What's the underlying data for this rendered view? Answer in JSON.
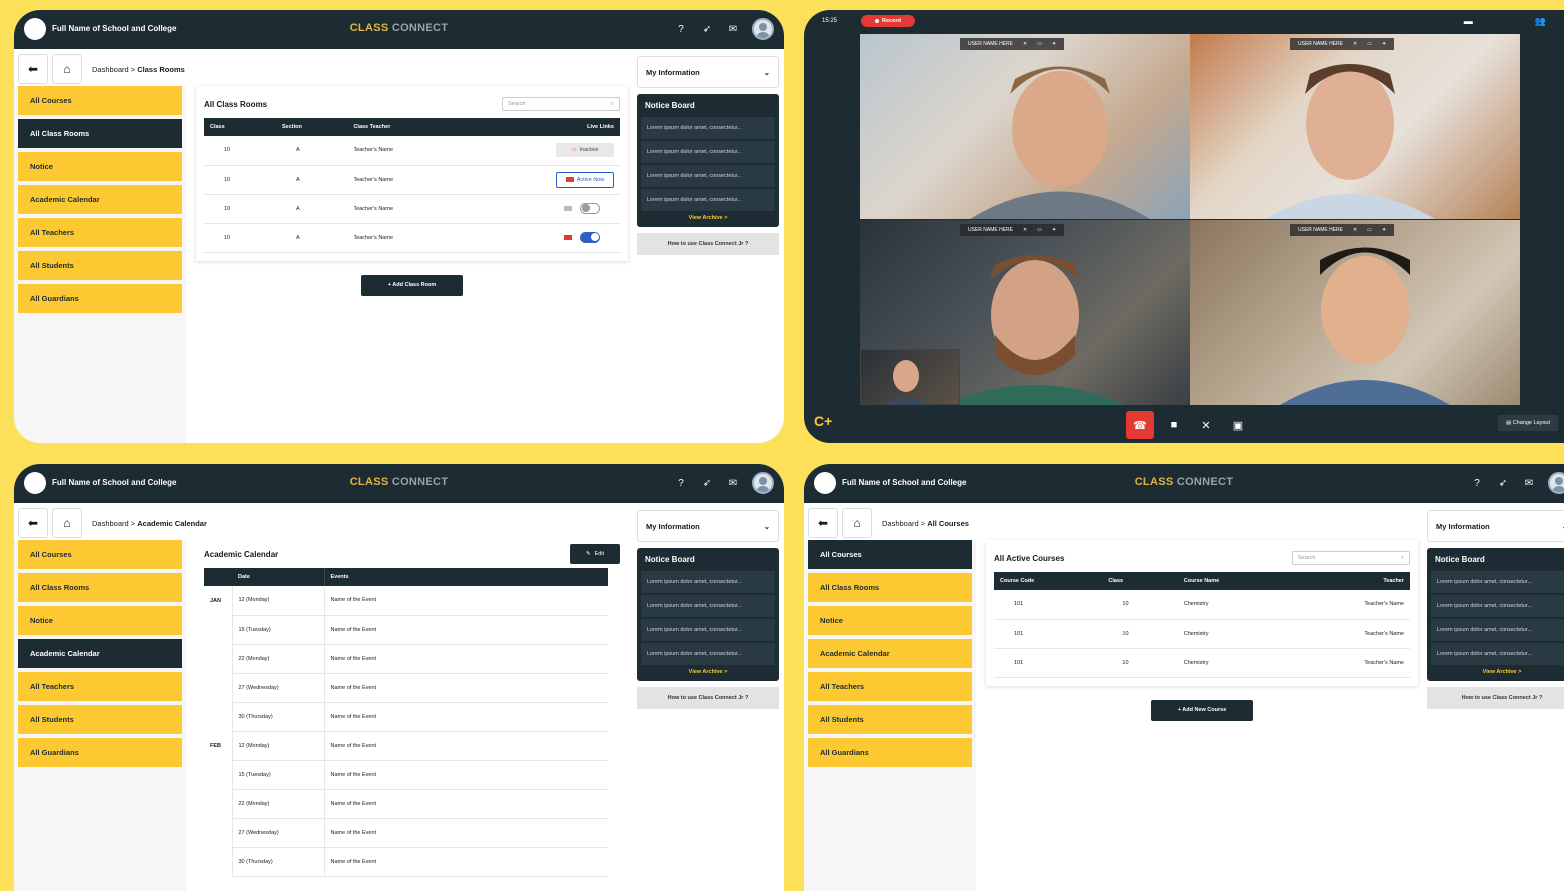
{
  "header": {
    "school": "Full Name of School and College",
    "brand_a": "CLASS",
    "brand_b": " CONNECT"
  },
  "breadcrumb": {
    "root": "Dashboard",
    "sep": " > ",
    "p1": "Class Rooms",
    "p3": "Academic Calendar",
    "p4": "All Courses"
  },
  "sidebar": {
    "items": [
      "All Courses",
      "All Class Rooms",
      "Notice",
      "Academic Calendar",
      "All Teachers",
      "All Students",
      "All Guardians"
    ]
  },
  "right": {
    "myinfo": "My Information",
    "notice_title": "Notice Board",
    "notices": [
      "Lorem ipsum dolor amet, consectetur...",
      "Lorem ipsum dolor amet, consectetur...",
      "Lorem ipsum dolor amet, consectetur...",
      "Lorem ipsum dolor amet, consectetur..."
    ],
    "archive": "View Archive >",
    "howto": "How to use Class Connect Jr ?"
  },
  "classrooms": {
    "title": "All Class Rooms",
    "search_placeholder": "Search",
    "headers": [
      "Class",
      "Section",
      "Class Teacher",
      "Live Links"
    ],
    "rows": [
      {
        "c": "10",
        "s": "A",
        "t": "Teacher's Name",
        "link": "Inactive"
      },
      {
        "c": "10",
        "s": "A",
        "t": "Teacher's Name",
        "link": "Active Now"
      },
      {
        "c": "10",
        "s": "A",
        "t": "Teacher's Name",
        "toggle": "off"
      },
      {
        "c": "10",
        "s": "A",
        "t": "Teacher's Name",
        "toggle": "on"
      }
    ],
    "add_btn": "+ Add Class Room"
  },
  "video": {
    "time": "15:25",
    "record": "Record",
    "username": "USER NAME HERE",
    "change_layout": "Change Layout",
    "logo": "C+"
  },
  "calendar": {
    "title": "Academic Calendar",
    "edit": "Edit",
    "headers": [
      "",
      "Date",
      "Events"
    ],
    "rows": [
      {
        "m": "JAN",
        "d": "12 (Monday)",
        "e": "Name of the Event"
      },
      {
        "m": "",
        "d": "15 (Tuesday)",
        "e": "Name of the Event"
      },
      {
        "m": "",
        "d": "22 (Monday)",
        "e": "Name of the Event"
      },
      {
        "m": "",
        "d": "27 (Wednesday)",
        "e": "Name of the Event"
      },
      {
        "m": "",
        "d": "30 (Thursday)",
        "e": "Name of the Event"
      },
      {
        "m": "FEB",
        "d": "12 (Monday)",
        "e": "Name of the Event"
      },
      {
        "m": "",
        "d": "15 (Tuesday)",
        "e": "Name of the Event"
      },
      {
        "m": "",
        "d": "22 (Monday)",
        "e": "Name of the Event"
      },
      {
        "m": "",
        "d": "27 (Wednesday)",
        "e": "Name of the Event"
      },
      {
        "m": "",
        "d": "30 (Thursday)",
        "e": "Name of the Event"
      }
    ]
  },
  "courses": {
    "title": "All Active Courses",
    "search_placeholder": "Search",
    "headers": [
      "Course Code",
      "Class",
      "Course Name",
      "Teacher"
    ],
    "rows": [
      {
        "code": "101",
        "c": "10",
        "n": "Chemistry",
        "t": "Teacher's Name"
      },
      {
        "code": "101",
        "c": "10",
        "n": "Chemistry",
        "t": "Teacher's Name"
      },
      {
        "code": "101",
        "c": "10",
        "n": "Chemistry",
        "t": "Teacher's Name"
      }
    ],
    "add_btn": "+ Add New Course"
  }
}
